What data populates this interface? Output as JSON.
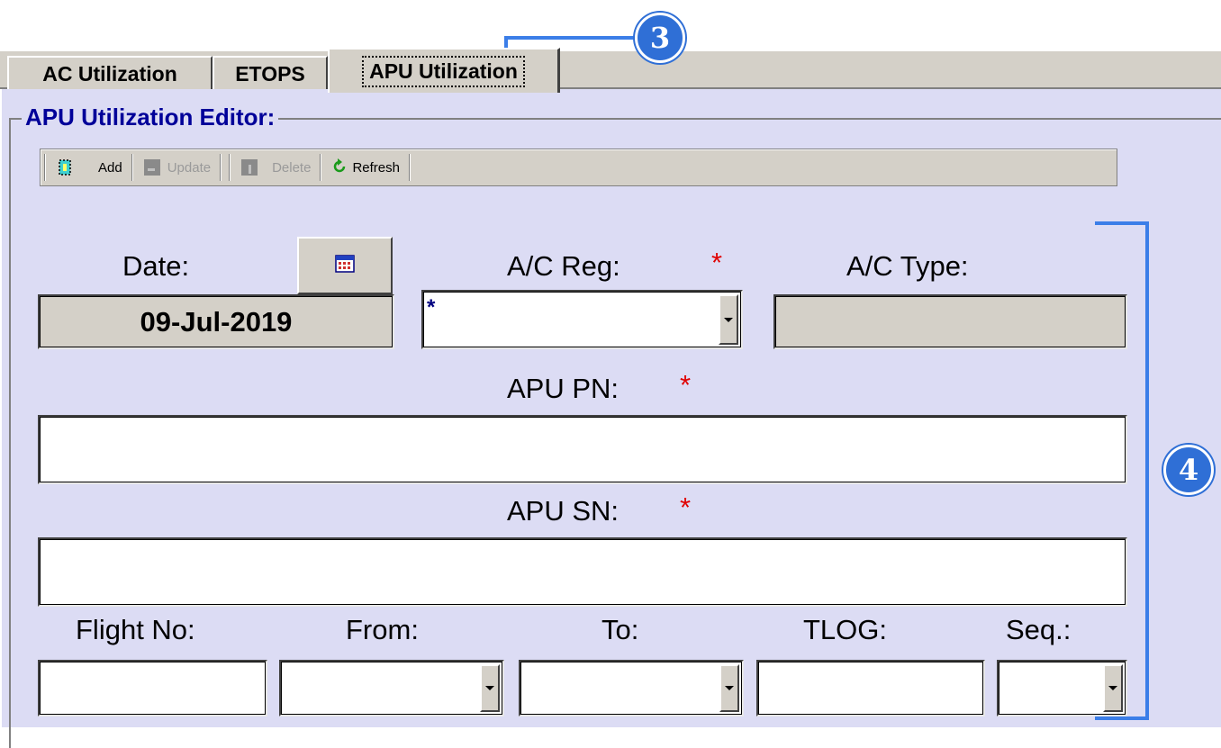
{
  "tabs": [
    {
      "label": "AC Utilization",
      "active": false
    },
    {
      "label": "ETOPS",
      "active": false
    },
    {
      "label": "APU Utilization",
      "active": true
    }
  ],
  "group": {
    "title": "APU Utilization Editor:"
  },
  "toolbar": {
    "add_label": "Add",
    "update_label": "Update",
    "delete_label": "Delete",
    "refresh_label": "Refresh"
  },
  "form": {
    "date": {
      "label": "Date:",
      "value": "09-Jul-2019"
    },
    "ac_reg": {
      "label": "A/C Reg:",
      "value": "*",
      "required": "*"
    },
    "ac_type": {
      "label": "A/C Type:",
      "value": ""
    },
    "apu_pn": {
      "label": "APU PN:",
      "value": "",
      "required": "*"
    },
    "apu_sn": {
      "label": "APU SN:",
      "value": "",
      "required": "*"
    },
    "flight_no": {
      "label": "Flight No:",
      "value": ""
    },
    "from": {
      "label": "From:",
      "value": ""
    },
    "to": {
      "label": "To:",
      "value": ""
    },
    "tlog": {
      "label": "TLOG:",
      "value": ""
    },
    "seq": {
      "label": "Seq.:",
      "value": ""
    }
  },
  "callouts": {
    "tabs_marker": "3",
    "form_marker": "4"
  },
  "colors": {
    "panel_bg": "#dcdcf4",
    "title_blue": "#000099",
    "required_red": "#e00000",
    "callout_blue": "#2f6fd6"
  }
}
